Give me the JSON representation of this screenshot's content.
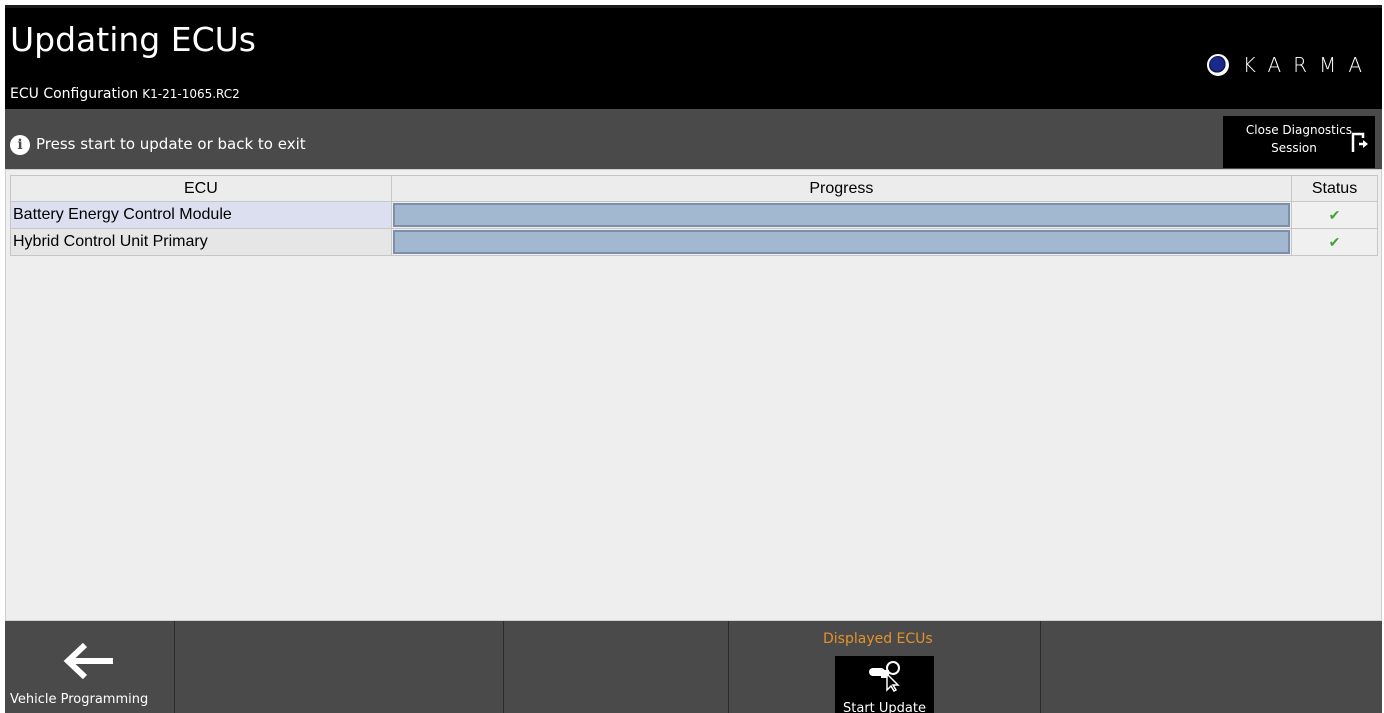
{
  "header": {
    "title": "Updating ECUs",
    "config_label": "ECU Configuration",
    "config_version": "K1-21-1065.RC2",
    "brand": "KARMA"
  },
  "infobar": {
    "message": "Press start to update or back to exit",
    "close_line1": "Close Diagnostics",
    "close_line2": "Session"
  },
  "table": {
    "headers": {
      "ecu": "ECU",
      "progress": "Progress",
      "status": "Status"
    },
    "rows": [
      {
        "ecu": "Battery Energy Control Module",
        "progress": 1.0,
        "status": "✔"
      },
      {
        "ecu": "Hybrid Control Unit Primary",
        "progress": 1.0,
        "status": "✔"
      }
    ]
  },
  "bottom": {
    "back_label": "Vehicle Programming",
    "group_label": "Displayed ECUs",
    "start_label": "Start Update"
  },
  "colors": {
    "accent_orange": "#e3922b",
    "progress_fill": "#a2b7d0",
    "status_ok": "#3aa533"
  }
}
